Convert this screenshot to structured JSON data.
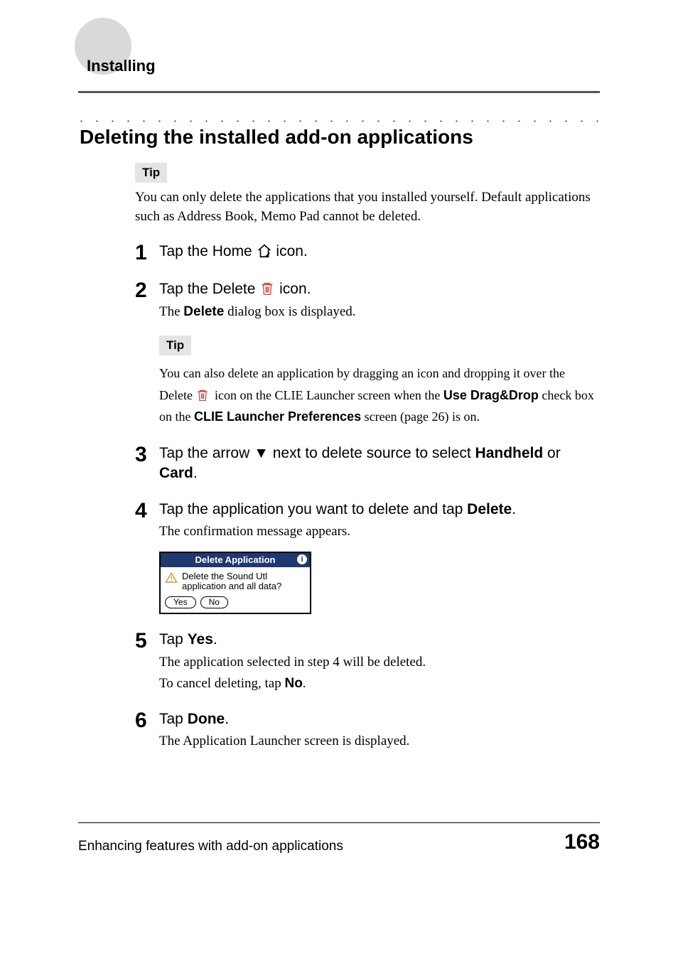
{
  "header": {
    "section_tab": "Installing"
  },
  "title": "Deleting the installed add-on applications",
  "intro": {
    "tip_label": "Tip",
    "tip_text": "You can only delete the applications that you installed yourself. Default applications such as Address Book, Memo Pad cannot be deleted."
  },
  "steps": [
    {
      "num": "1",
      "line_pre": "Tap the Home ",
      "line_post": " icon."
    },
    {
      "num": "2",
      "line_pre": "Tap the Delete ",
      "line_post": " icon.",
      "sub_pre": "The ",
      "sub_bold": "Delete",
      "sub_post": " dialog box is displayed.",
      "tip": {
        "label": "Tip",
        "t1": "You can also delete an application by dragging an icon and dropping it over the ",
        "t2_pre": "Delete ",
        "t2_mid": " icon on the CLIE Launcher screen when the ",
        "t2_bold": "Use Drag&Drop",
        "t2_post": " check ",
        "t3_pre": "box on the ",
        "t3_bold": "CLIE Launcher Preferences",
        "t3_post": " screen (page 26) is on."
      }
    },
    {
      "num": "3",
      "line_pre": "Tap the arrow ",
      "line_mid": " next to delete source to select ",
      "bold_a": "Handheld",
      "line_join": " or ",
      "bold_b": "Card",
      "line_end": "."
    },
    {
      "num": "4",
      "line_pre": "Tap the application you want to delete and tap ",
      "bold_a": "Delete",
      "line_end": ".",
      "sub": "The confirmation message appears."
    },
    {
      "num": "5",
      "line_pre": "Tap ",
      "bold_a": "Yes",
      "line_end": ".",
      "sub1": "The application selected in step 4 will be deleted.",
      "sub2_pre": "To cancel deleting, tap ",
      "sub2_bold": "No",
      "sub2_end": "."
    },
    {
      "num": "6",
      "line_pre": "Tap ",
      "bold_a": "Done",
      "line_end": ".",
      "sub": "The Application Launcher screen is displayed."
    }
  ],
  "dialog": {
    "title": "Delete Application",
    "info_char": "i",
    "msg": "Delete the Sound Utl application and all data?",
    "yes": "Yes",
    "no": "No"
  },
  "footer": {
    "chapter": "Enhancing features with add-on applications",
    "page": "168"
  }
}
